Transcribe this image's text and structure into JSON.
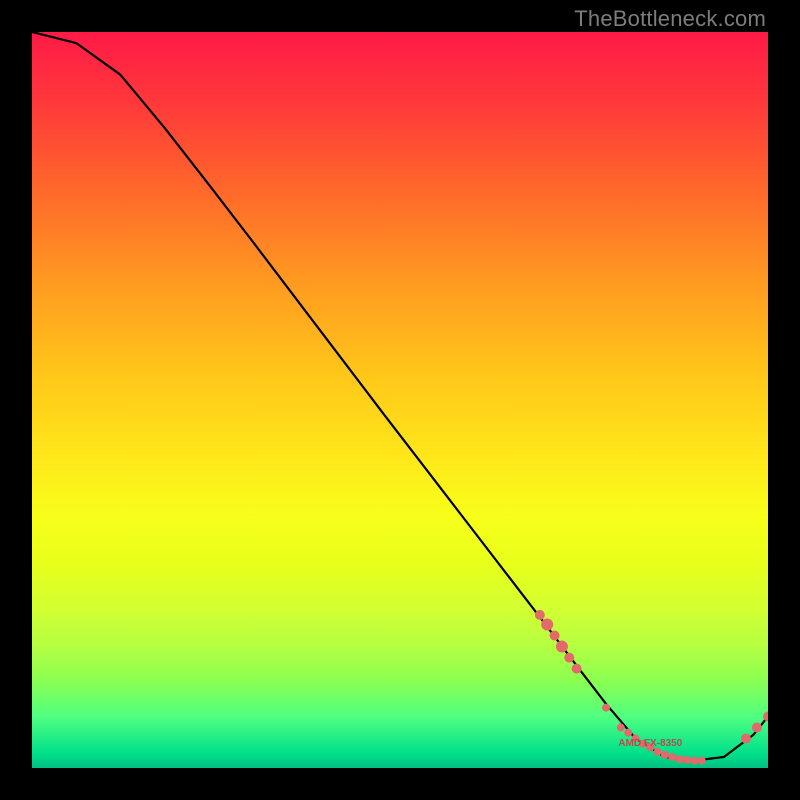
{
  "attribution": "TheBottleneck.com",
  "colors": {
    "frame": "#000000",
    "curve": "#000000",
    "marker_fill": "#e36a6a",
    "marker_label": "#b05050",
    "gradient_top": "#ff1a47",
    "gradient_bottom": "#00c080"
  },
  "chart_data": {
    "type": "line",
    "title": "",
    "xlabel": "",
    "ylabel": "",
    "xlim": [
      0,
      100
    ],
    "ylim": [
      0,
      100
    ],
    "grid": false,
    "legend": false,
    "x": [
      0,
      6,
      12,
      18,
      24,
      30,
      36,
      42,
      48,
      54,
      60,
      66,
      70,
      74,
      78,
      82,
      86,
      90,
      94,
      98,
      100
    ],
    "values": [
      100,
      98.5,
      94.2,
      87.0,
      79.3,
      71.5,
      63.6,
      55.7,
      47.8,
      40.0,
      32.2,
      24.4,
      19.2,
      13.9,
      8.7,
      4.0,
      1.5,
      1.0,
      1.5,
      4.5,
      7.0
    ],
    "marker_cluster": {
      "note": "salmon dots along the valley region with a tiny text label",
      "label_text": "AMD FX-8350",
      "label_xy": [
        84,
        3
      ],
      "points": [
        {
          "x": 69,
          "y": 20.8,
          "r": 5
        },
        {
          "x": 70,
          "y": 19.5,
          "r": 6
        },
        {
          "x": 71,
          "y": 18.0,
          "r": 5
        },
        {
          "x": 72,
          "y": 16.5,
          "r": 6
        },
        {
          "x": 73,
          "y": 15.0,
          "r": 5
        },
        {
          "x": 74,
          "y": 13.5,
          "r": 5
        },
        {
          "x": 78,
          "y": 8.2,
          "r": 4
        },
        {
          "x": 80,
          "y": 5.5,
          "r": 4
        },
        {
          "x": 81,
          "y": 4.8,
          "r": 4
        },
        {
          "x": 82,
          "y": 4.0,
          "r": 4
        },
        {
          "x": 83,
          "y": 3.3,
          "r": 4
        },
        {
          "x": 84,
          "y": 2.8,
          "r": 4
        },
        {
          "x": 85,
          "y": 2.2,
          "r": 4
        },
        {
          "x": 86,
          "y": 1.8,
          "r": 4
        },
        {
          "x": 87,
          "y": 1.5,
          "r": 4
        },
        {
          "x": 88,
          "y": 1.2,
          "r": 4
        },
        {
          "x": 89,
          "y": 1.1,
          "r": 4
        },
        {
          "x": 90,
          "y": 1.0,
          "r": 4
        },
        {
          "x": 91,
          "y": 1.0,
          "r": 4
        },
        {
          "x": 97,
          "y": 4.0,
          "r": 5
        },
        {
          "x": 98.5,
          "y": 5.5,
          "r": 5
        },
        {
          "x": 100,
          "y": 7.0,
          "r": 5
        }
      ]
    }
  }
}
